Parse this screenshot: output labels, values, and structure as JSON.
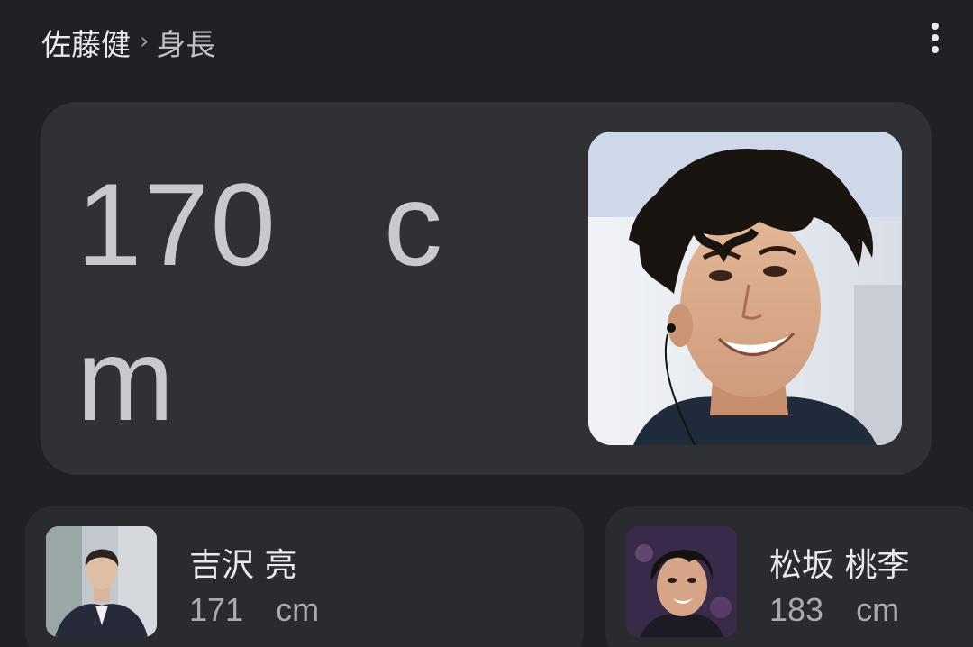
{
  "breadcrumb": {
    "entity": "佐藤健",
    "separator": "›",
    "attribute": "身長"
  },
  "menu": {
    "icon": "more-vert-icon"
  },
  "answer": {
    "value_text": "170 cm",
    "photo_subject": "佐藤健"
  },
  "related": [
    {
      "name": "吉沢 亮",
      "height": "171",
      "unit": "cm"
    },
    {
      "name": "松坂 桃李",
      "height": "183",
      "unit": "cm"
    }
  ],
  "colors": {
    "background": "#202124",
    "card": "#303134",
    "related_card": "#2a2b2e",
    "text_primary": "#e8eaed",
    "text_secondary": "#a8abaf"
  }
}
